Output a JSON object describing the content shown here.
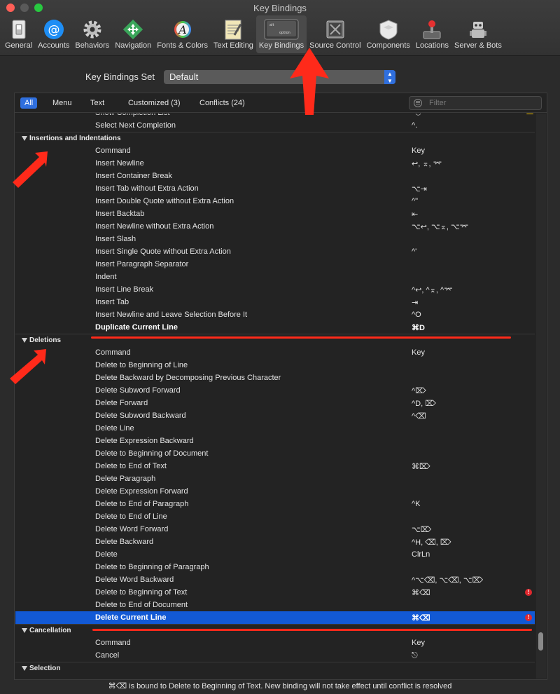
{
  "window": {
    "title": "Key Bindings"
  },
  "toolbar": {
    "tabs": [
      {
        "label": "General",
        "icon": "switch-icon"
      },
      {
        "label": "Accounts",
        "icon": "at-sign-icon"
      },
      {
        "label": "Behaviors",
        "icon": "gear-icon"
      },
      {
        "label": "Navigation",
        "icon": "move-arrows-icon"
      },
      {
        "label": "Fonts & Colors",
        "icon": "font-color-icon"
      },
      {
        "label": "Text Editing",
        "icon": "notepad-icon"
      },
      {
        "label": "Key Bindings",
        "icon": "keyboard-key-icon",
        "active": true
      },
      {
        "label": "Source Control",
        "icon": "source-control-icon"
      },
      {
        "label": "Components",
        "icon": "shield-box-icon"
      },
      {
        "label": "Locations",
        "icon": "joystick-icon"
      },
      {
        "label": "Server & Bots",
        "icon": "robot-icon"
      }
    ],
    "key_icon_top": "alt",
    "key_icon_bottom": "option"
  },
  "key_bindings_set": {
    "label": "Key Bindings Set",
    "value": "Default"
  },
  "filters": {
    "all": "All",
    "menu": "Menu",
    "text": "Text",
    "customized": "Customized (3)",
    "conflicts": "Conflicts (24)",
    "search_placeholder": "Filter"
  },
  "list": {
    "rows": [
      {
        "kind": "row",
        "command": "Show Completion List",
        "key": "^⎋",
        "warn": true
      },
      {
        "kind": "row",
        "command": "Select Next Completion",
        "key": "^."
      },
      {
        "kind": "section",
        "label": "Insertions and Indentations"
      },
      {
        "kind": "row",
        "command": "Command",
        "key": "Key"
      },
      {
        "kind": "row",
        "command": "Insert Newline",
        "key": "    ↩, ⌅, ⌤"
      },
      {
        "kind": "row",
        "command": "Insert Container Break",
        "key": ""
      },
      {
        "kind": "row",
        "command": "Insert Tab without Extra Action",
        "key": "⌥⇥"
      },
      {
        "kind": "row",
        "command": "Insert Double Quote without Extra Action",
        "key": "^\""
      },
      {
        "kind": "row",
        "command": "Insert Backtab",
        "key": "    ⇤"
      },
      {
        "kind": "row",
        "command": "Insert Newline without Extra Action",
        "key": "⌥↩, ⌥⌅, ⌥⌤"
      },
      {
        "kind": "row",
        "command": "Insert Slash",
        "key": ""
      },
      {
        "kind": "row",
        "command": "Insert Single Quote without Extra Action",
        "key": "^'"
      },
      {
        "kind": "row",
        "command": "Insert Paragraph Separator",
        "key": ""
      },
      {
        "kind": "row",
        "command": "Indent",
        "key": ""
      },
      {
        "kind": "row",
        "command": "Insert Line Break",
        "key": "^↩, ^⌅, ^⌤"
      },
      {
        "kind": "row",
        "command": "Insert Tab",
        "key": "    ⇥"
      },
      {
        "kind": "row",
        "command": "Insert Newline and Leave Selection Before It",
        "key": "^O"
      },
      {
        "kind": "row",
        "command": "Duplicate Current Line",
        "key": "⌘D",
        "bold": true
      },
      {
        "kind": "section",
        "label": "Deletions"
      },
      {
        "kind": "row",
        "command": "Command",
        "key": "Key"
      },
      {
        "kind": "row",
        "command": "Delete to Beginning of Line",
        "key": ""
      },
      {
        "kind": "row",
        "command": "Delete Backward by Decomposing Previous Character",
        "key": ""
      },
      {
        "kind": "row",
        "command": "Delete Subword Forward",
        "key": "^⌦"
      },
      {
        "kind": "row",
        "command": "Delete Forward",
        "key": "^D, ⌦"
      },
      {
        "kind": "row",
        "command": "Delete Subword Backward",
        "key": "^⌫"
      },
      {
        "kind": "row",
        "command": "Delete Line",
        "key": ""
      },
      {
        "kind": "row",
        "command": "Delete Expression Backward",
        "key": ""
      },
      {
        "kind": "row",
        "command": "Delete to Beginning of Document",
        "key": ""
      },
      {
        "kind": "row",
        "command": "Delete to End of Text",
        "key": "⌘⌦"
      },
      {
        "kind": "row",
        "command": "Delete Paragraph",
        "key": ""
      },
      {
        "kind": "row",
        "command": "Delete Expression Forward",
        "key": ""
      },
      {
        "kind": "row",
        "command": "Delete to End of Paragraph",
        "key": "^K"
      },
      {
        "kind": "row",
        "command": "Delete to End of Line",
        "key": ""
      },
      {
        "kind": "row",
        "command": "Delete Word Forward",
        "key": "⌥⌦"
      },
      {
        "kind": "row",
        "command": "Delete Backward",
        "key": "^H, ⌫, ⌦"
      },
      {
        "kind": "row",
        "command": "Delete",
        "key": " ClrLn"
      },
      {
        "kind": "row",
        "command": "Delete to Beginning of Paragraph",
        "key": ""
      },
      {
        "kind": "row",
        "command": "Delete Word Backward",
        "key": "^⌥⌫, ⌥⌫, ⌥⌦"
      },
      {
        "kind": "row",
        "command": "Delete to Beginning of Text",
        "key": "⌘⌫",
        "error": true
      },
      {
        "kind": "row",
        "command": "Delete to End of Document",
        "key": ""
      },
      {
        "kind": "row",
        "command": "Delete Current Line",
        "key": "⌘⌫",
        "selected": true,
        "error": true
      },
      {
        "kind": "section",
        "label": "Cancellation"
      },
      {
        "kind": "row",
        "command": "Command",
        "key": "Key"
      },
      {
        "kind": "row",
        "command": "Cancel",
        "key": "    ⎋"
      },
      {
        "kind": "section",
        "label": "Selection"
      }
    ]
  },
  "status_message": "⌘⌫ is bound to Delete to Beginning of Text.  New binding will not take effect until conflict is resolved",
  "colors": {
    "accent": "#1259d5",
    "annotation": "#ff2a1a",
    "error": "#e0282e",
    "warning": "#f0c000"
  }
}
